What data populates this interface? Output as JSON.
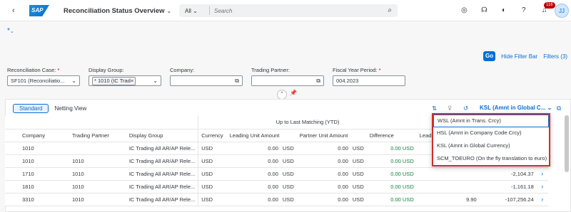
{
  "shell": {
    "back": "‹",
    "logo": "SAP",
    "title": "Reconciliation Status Overview",
    "search_scope": "All",
    "search_placeholder": "Search",
    "notification_count": "116",
    "avatar": "JJ"
  },
  "variant": {
    "label": "*"
  },
  "filterbar": {
    "go": "Go",
    "hide": "Hide Filter Bar",
    "filters": "Filters (3)",
    "fields": [
      {
        "label": "Reconciliation Case:",
        "required": true,
        "value": "SF101 (Reconciliatio..."
      },
      {
        "label": "Display Group:",
        "required": false,
        "token": "* 1010 (IC Trad"
      },
      {
        "label": "Company:",
        "required": false,
        "value": ""
      },
      {
        "label": "Trading Partner:",
        "required": false,
        "value": ""
      },
      {
        "label": "Fiscal Year Period:",
        "required": true,
        "value": "004.2023"
      }
    ]
  },
  "toolbar": {
    "standard": "Standard",
    "netting": "Netting View",
    "currency_select": "KSL (Amnt in Global C..."
  },
  "table": {
    "group_header": "Up to Last Matching (YTD)",
    "columns": [
      "Company",
      "Trading Partner",
      "Display Group",
      "Currency",
      "Leading Unit Amount",
      "Partner Unit Amount",
      "Difference",
      "Leadi"
    ],
    "rows": [
      {
        "company": "1010",
        "partner": "",
        "group": "IC Trading All AR/AP Rele...",
        "currency": "USD",
        "leading": "0.00",
        "lcur": "USD",
        "partner_amt": "0.00",
        "pcur": "USD",
        "diff": "0.00 USD",
        "extra": ""
      },
      {
        "company": "1010",
        "partner": "1010",
        "group": "IC Trading All AR/AP Rele...",
        "currency": "USD",
        "leading": "0.00",
        "lcur": "USD",
        "partner_amt": "0.00",
        "pcur": "USD",
        "diff": "0.00 USD",
        "extra": ""
      },
      {
        "company": "1710",
        "partner": "1010",
        "group": "IC Trading All AR/AP Rele...",
        "currency": "USD",
        "leading": "0.00",
        "lcur": "USD",
        "partner_amt": "0.00",
        "pcur": "USD",
        "diff": "0.00 USD",
        "extra": "-2,104.37"
      },
      {
        "company": "1810",
        "partner": "1010",
        "group": "IC Trading All AR/AP Rele...",
        "currency": "USD",
        "leading": "0.00",
        "lcur": "USD",
        "partner_amt": "0.00",
        "pcur": "USD",
        "diff": "0.00 USD",
        "extra": "-1,161.18"
      },
      {
        "company": "3310",
        "partner": "1010",
        "group": "IC Trading All AR/AP Rele...",
        "currency": "USD",
        "leading": "0.00",
        "lcur": "USD",
        "partner_amt": "0.00",
        "pcur": "USD",
        "diff": "0.00 USD",
        "extra": "-107,256.24",
        "extra_prefix": "9.90"
      }
    ]
  },
  "dropdown": {
    "options": [
      "WSL (Amnt in Trans. Crcy)",
      "HSL (Amnt in Company Code Crcy)",
      "KSL (Amnt in Global Currency)",
      "SCM_TOEURO (On the fly translation to euro)"
    ]
  },
  "colors": {
    "brand": "#0a6ed1",
    "positive": "#107e3e",
    "highlight": "#d22c2c"
  }
}
